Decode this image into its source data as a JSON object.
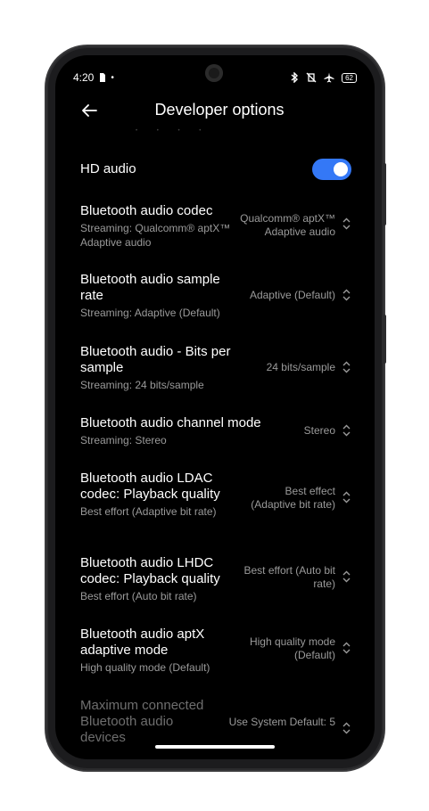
{
  "status_bar": {
    "time": "4:20",
    "battery": "62"
  },
  "header": {
    "title": "Developer options"
  },
  "accent_color": "#3478f6",
  "settings": [
    {
      "title": "HD audio",
      "subtitle": "",
      "value": "",
      "toggle": true
    },
    {
      "title": "Bluetooth audio codec",
      "subtitle": "Streaming: Qualcomm® aptX™ Adaptive audio",
      "value": "Qualcomm® aptX™ Adaptive audio"
    },
    {
      "title": "Bluetooth audio sample rate",
      "subtitle": "Streaming: Adaptive (Default)",
      "value": "Adaptive (Default)"
    },
    {
      "title": "Bluetooth audio - Bits per sample",
      "subtitle": "Streaming: 24 bits/sample",
      "value": "24 bits/sample"
    },
    {
      "title": "Bluetooth audio channel mode",
      "subtitle": "Streaming: Stereo",
      "value": "Stereo"
    },
    {
      "title": "Bluetooth audio LDAC codec: Playback quality",
      "subtitle": "Best effort (Adaptive bit rate)",
      "value": "Best effect (Adaptive bit rate)"
    },
    {
      "title": "Bluetooth audio LHDC codec: Playback quality",
      "subtitle": "Best effort (Auto bit rate)",
      "value": "Best effort (Auto bit rate)"
    },
    {
      "title": "Bluetooth audio aptX adaptive mode",
      "subtitle": "High quality mode (Default)",
      "value": "High quality mode (Default)"
    },
    {
      "title": "Maximum connected Bluetooth audio devices",
      "subtitle": "",
      "value": "Use System Default: 5",
      "disabled": true
    }
  ]
}
